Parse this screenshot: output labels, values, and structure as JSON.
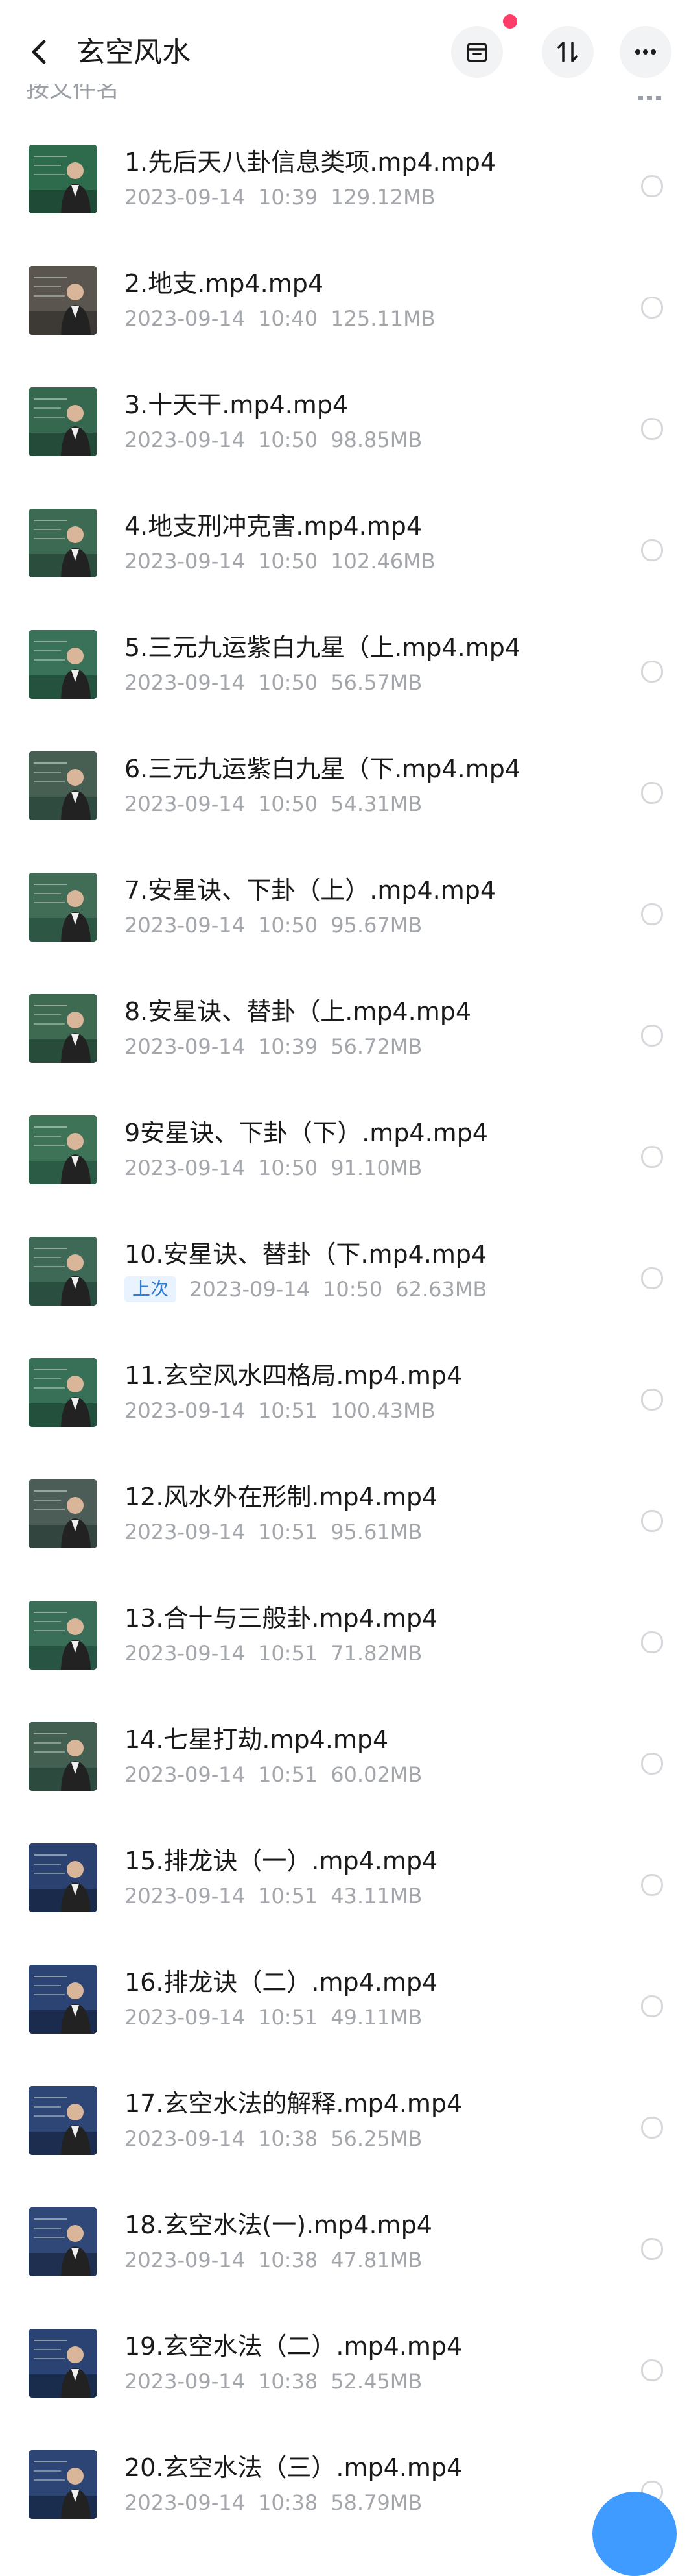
{
  "header": {
    "title": "玄空风水",
    "back_icon": "chevron-left-icon",
    "buttons": [
      "archive-icon",
      "sort-icon",
      "more-icon"
    ],
    "notification_color": "#ff3d6b"
  },
  "sort_bar": {
    "label": "按文件名"
  },
  "files": [
    {
      "name": "1.先后天八卦信息类项.mp4.mp4",
      "date": "2023-09-14",
      "time": "10:39",
      "size": "129.12MB",
      "tag": ""
    },
    {
      "name": "2.地支.mp4.mp4",
      "date": "2023-09-14",
      "time": "10:40",
      "size": "125.11MB",
      "tag": ""
    },
    {
      "name": "3.十天干.mp4.mp4",
      "date": "2023-09-14",
      "time": "10:50",
      "size": "98.85MB",
      "tag": ""
    },
    {
      "name": "4.地支刑冲克害.mp4.mp4",
      "date": "2023-09-14",
      "time": "10:50",
      "size": "102.46MB",
      "tag": ""
    },
    {
      "name": "5.三元九运紫白九星（上.mp4.mp4",
      "date": "2023-09-14",
      "time": "10:50",
      "size": "56.57MB",
      "tag": ""
    },
    {
      "name": "6.三元九运紫白九星（下.mp4.mp4",
      "date": "2023-09-14",
      "time": "10:50",
      "size": "54.31MB",
      "tag": ""
    },
    {
      "name": "7.安星诀、下卦（上）.mp4.mp4",
      "date": "2023-09-14",
      "time": "10:50",
      "size": "95.67MB",
      "tag": ""
    },
    {
      "name": "8.安星诀、替卦（上.mp4.mp4",
      "date": "2023-09-14",
      "time": "10:39",
      "size": "56.72MB",
      "tag": ""
    },
    {
      "name": "9安星诀、下卦（下）.mp4.mp4",
      "date": "2023-09-14",
      "time": "10:50",
      "size": "91.10MB",
      "tag": ""
    },
    {
      "name": "10.安星诀、替卦（下.mp4.mp4",
      "date": "2023-09-14",
      "time": "10:50",
      "size": "62.63MB",
      "tag": "上次"
    },
    {
      "name": "11.玄空风水四格局.mp4.mp4",
      "date": "2023-09-14",
      "time": "10:51",
      "size": "100.43MB",
      "tag": ""
    },
    {
      "name": "12.风水外在形制.mp4.mp4",
      "date": "2023-09-14",
      "time": "10:51",
      "size": "95.61MB",
      "tag": ""
    },
    {
      "name": "13.合十与三般卦.mp4.mp4",
      "date": "2023-09-14",
      "time": "10:51",
      "size": "71.82MB",
      "tag": ""
    },
    {
      "name": "14.七星打劫.mp4.mp4",
      "date": "2023-09-14",
      "time": "10:51",
      "size": "60.02MB",
      "tag": ""
    },
    {
      "name": "15.排龙诀（一）.mp4.mp4",
      "date": "2023-09-14",
      "time": "10:51",
      "size": "43.11MB",
      "tag": ""
    },
    {
      "name": "16.排龙诀（二）.mp4.mp4",
      "date": "2023-09-14",
      "time": "10:51",
      "size": "49.11MB",
      "tag": ""
    },
    {
      "name": "17.玄空水法的解释.mp4.mp4",
      "date": "2023-09-14",
      "time": "10:38",
      "size": "56.25MB",
      "tag": ""
    },
    {
      "name": "18.玄空水法(一).mp4.mp4",
      "date": "2023-09-14",
      "time": "10:38",
      "size": "47.81MB",
      "tag": ""
    },
    {
      "name": "19.玄空水法（二）.mp4.mp4",
      "date": "2023-09-14",
      "time": "10:38",
      "size": "52.45MB",
      "tag": ""
    },
    {
      "name": "20.玄空水法（三）.mp4.mp4",
      "date": "2023-09-14",
      "time": "10:38",
      "size": "58.79MB",
      "tag": ""
    }
  ],
  "colors": {
    "accent": "#2b7bd9",
    "meta_text": "#a3a6ab",
    "fab": "#3f9bff"
  }
}
